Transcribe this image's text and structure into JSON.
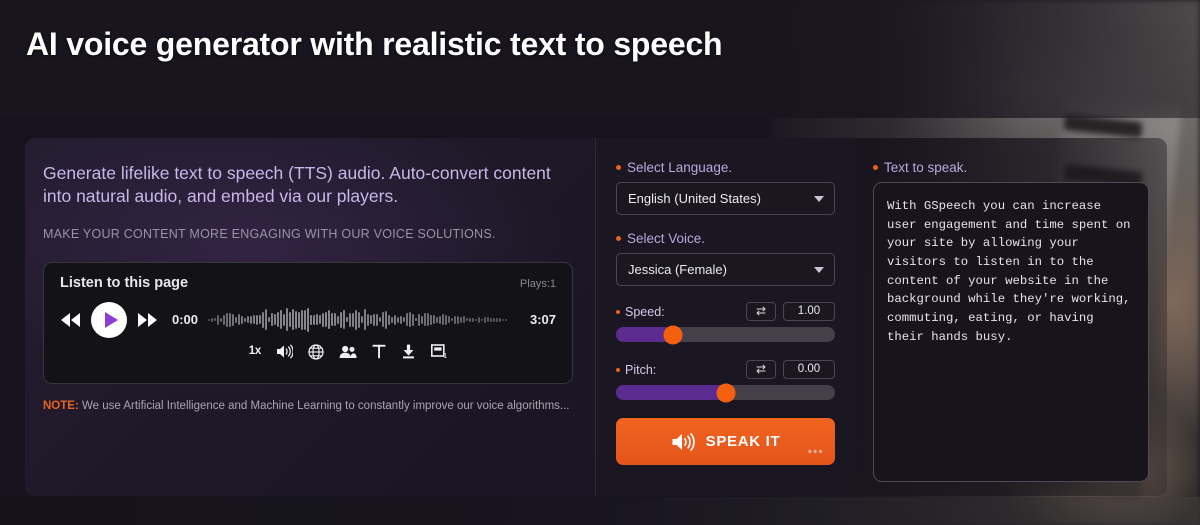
{
  "header": {
    "title": "AI voice generator with realistic text to speech"
  },
  "left": {
    "lead": "Generate lifelike text to speech (TTS) audio. Auto-convert content into natural audio, and embed via our players.",
    "subhead": "MAKE YOUR CONTENT MORE ENGAGING WITH OUR VOICE SOLUTIONS.",
    "note_prefix": "NOTE:",
    "note_text": " We use Artificial Intelligence and Machine Learning to constantly improve our voice algorithms..."
  },
  "player": {
    "title": "Listen to this page",
    "plays": "Plays:1",
    "current_time": "0:00",
    "total_time": "3:07",
    "rewind_icon": "rewind-icon",
    "play_icon": "play-icon",
    "forward_icon": "fast-forward-icon",
    "waveform_icon": "waveform",
    "speed_label": "1x",
    "icons": [
      {
        "name": "playback-speed",
        "label": "1x"
      },
      {
        "name": "volume-icon",
        "label": ""
      },
      {
        "name": "globe-icon",
        "label": ""
      },
      {
        "name": "people-icon",
        "label": ""
      },
      {
        "name": "text-icon",
        "label": ""
      },
      {
        "name": "download-icon",
        "label": ""
      },
      {
        "name": "embed-icon",
        "label": ""
      }
    ]
  },
  "form": {
    "language_label": "Select Language.",
    "language_value": "English (United States)",
    "voice_label": "Select Voice.",
    "voice_value": "Jessica (Female)",
    "speed_label": "Speed:",
    "speed_value": "1.00",
    "speed_percent": 26,
    "pitch_label": "Pitch:",
    "pitch_value": "0.00",
    "pitch_percent": 50,
    "reset_icon": "reset-loop-icon",
    "speak_button": "SPEAK IT",
    "speak_icon": "speaker-icon",
    "speak_dots": "•••"
  },
  "right": {
    "label": "Text to speak.",
    "text": "With GSpeech you can increase user engagement and time spent on your site by allowing your visitors to listen in to the content of your website in the background while they're working, commuting, eating, or having their hands busy."
  },
  "colors": {
    "accent_orange": "#e8621f",
    "accent_purple": "#8b3fd4",
    "slider_fill": "#5b2b8f",
    "background": "#17131e",
    "text_light": "#eceaf0"
  }
}
